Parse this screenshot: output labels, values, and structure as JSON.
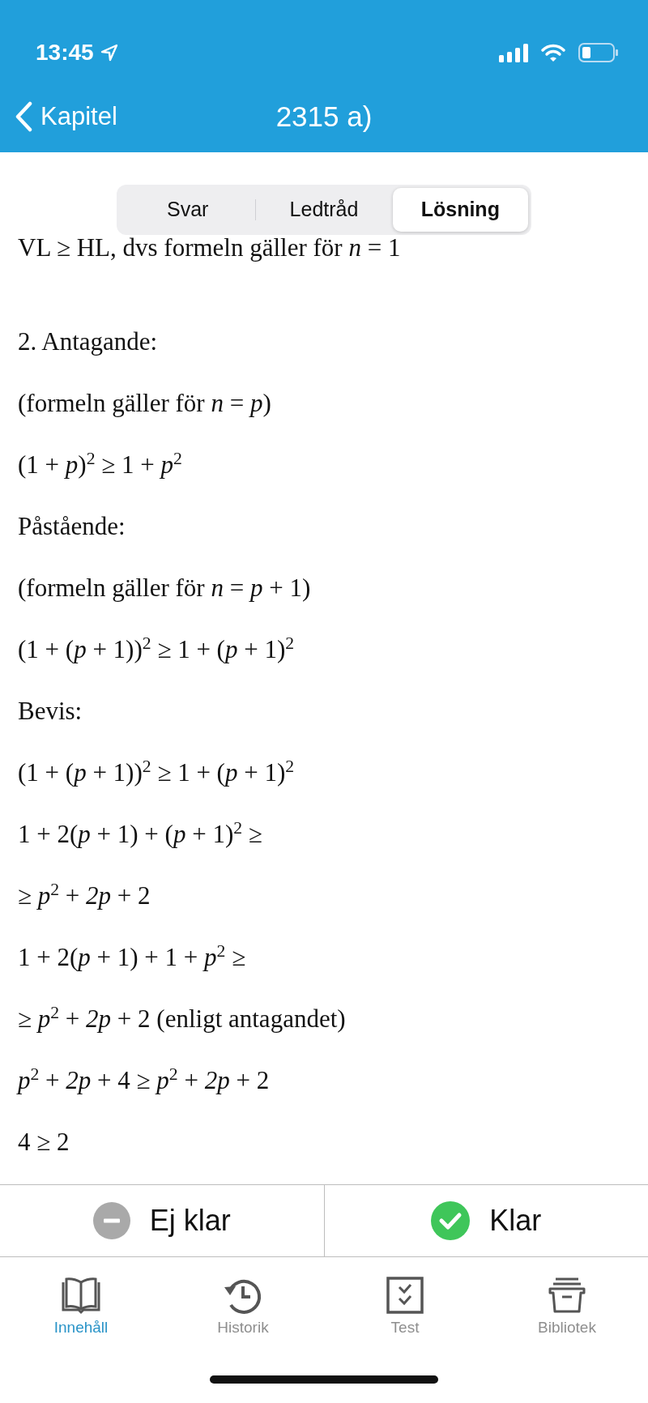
{
  "status_bar": {
    "time": "13:45"
  },
  "nav": {
    "back": "Kapitel",
    "title": "2315 a)"
  },
  "segments": [
    {
      "label": "Svar",
      "selected": false
    },
    {
      "label": "Ledtråd",
      "selected": false
    },
    {
      "label": "Lösning",
      "selected": true
    }
  ],
  "solution": {
    "top_line": "VL ≥ HL,  dvs formeln gäller för  *n* = 1",
    "lines": [
      "2. Antagande:",
      "(formeln gäller för  *n* = *p*)",
      "(1 + *p*)$^{2}$ ≥ 1 + *p*$^{2}$",
      "Påstående:",
      "(formeln gäller för  *n* = *p* + 1)",
      "(1 + (*p* + 1))$^{2}$ ≥ 1 + (*p* + 1)$^{2}$",
      "Bevis:",
      "(1 + (*p* + 1))$^{2}$ ≥ 1 + (*p* + 1)$^{2}$",
      "1 + 2(*p* + 1) + (*p* + 1)$^{2}$ ≥",
      "≥ *p*$^{2}$ + *2p* + 2",
      "1 + 2(*p* + 1) + 1 + *p*$^{2}$ ≥",
      "≥ *p*$^{2}$ + *2p* + 2  (enligt antagandet)",
      "*p*$^{2}$ + *2p* + 4 ≥ *p*$^{2}$ + *2p* + 2",
      "4 ≥ 2"
    ]
  },
  "actions": [
    {
      "label": "Ej klar",
      "kind": "not-done"
    },
    {
      "label": "Klar",
      "kind": "done"
    }
  ],
  "tab_bar": [
    {
      "label": "Innehåll",
      "kind": "book",
      "selected": true
    },
    {
      "label": "Historik",
      "kind": "history",
      "selected": false
    },
    {
      "label": "Test",
      "kind": "test",
      "selected": false
    },
    {
      "label": "Bibliotek",
      "kind": "archive",
      "selected": false
    }
  ]
}
